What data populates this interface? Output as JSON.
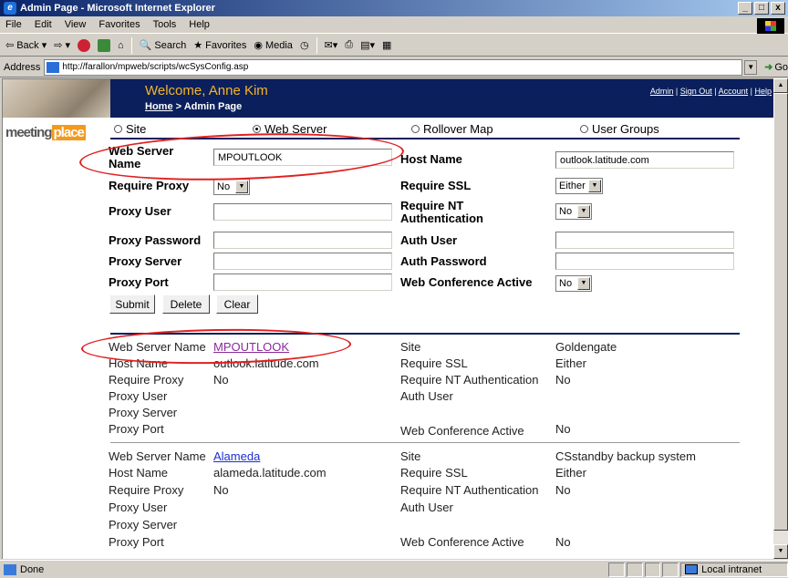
{
  "window": {
    "title": "Admin Page - Microsoft Internet Explorer",
    "controls": [
      "_",
      "□",
      "x"
    ]
  },
  "menu": [
    "File",
    "Edit",
    "View",
    "Favorites",
    "Tools",
    "Help"
  ],
  "toolbar": {
    "back": "Back",
    "search": "Search",
    "favorites": "Favorites",
    "media": "Media"
  },
  "address": {
    "label": "Address",
    "url": "http://farallon/mpweb/scripts/wcSysConfig.asp",
    "go": "Go"
  },
  "status": {
    "text": "Done",
    "zone": "Local intranet"
  },
  "header": {
    "welcome": "Welcome, Anne Kim",
    "breadcrumb_home": "Home",
    "breadcrumb_sep": " > ",
    "breadcrumb_page": "Admin Page",
    "links": [
      "Admin",
      "Sign Out",
      "Account",
      "Help"
    ]
  },
  "logo": {
    "part1": "meeting",
    "part2": "place"
  },
  "tabs": [
    {
      "label": "Site",
      "selected": false
    },
    {
      "label": "Web Server",
      "selected": true
    },
    {
      "label": "Rollover Map",
      "selected": false
    },
    {
      "label": "User Groups",
      "selected": false
    }
  ],
  "form": {
    "web_server_name": {
      "label": "Web Server Name",
      "value": "MPOUTLOOK"
    },
    "host_name": {
      "label": "Host Name",
      "value": "outlook.latitude.com"
    },
    "require_proxy": {
      "label": "Require Proxy",
      "value": "No"
    },
    "require_ssl": {
      "label": "Require SSL",
      "value": "Either"
    },
    "proxy_user": {
      "label": "Proxy User",
      "value": ""
    },
    "require_nt": {
      "label": "Require NT Authentication",
      "value": "No"
    },
    "proxy_password": {
      "label": "Proxy Password",
      "value": ""
    },
    "auth_user": {
      "label": "Auth User",
      "value": ""
    },
    "proxy_server": {
      "label": "Proxy Server",
      "value": ""
    },
    "auth_password": {
      "label": "Auth Password",
      "value": ""
    },
    "proxy_port": {
      "label": "Proxy Port",
      "value": ""
    },
    "web_conf_active": {
      "label": "Web Conference Active",
      "value": "No"
    },
    "buttons": {
      "submit": "Submit",
      "delete": "Delete",
      "clear": "Clear"
    }
  },
  "records": [
    {
      "labels": {
        "name": "Web Server Name",
        "host": "Host Name",
        "proxy": "Require Proxy",
        "puser": "Proxy User",
        "pserver": "Proxy Server",
        "pport": "Proxy Port",
        "site": "Site",
        "ssl": "Require SSL",
        "nt": "Require NT Authentication",
        "auth": "Auth User",
        "wca": "Web Conference Active"
      },
      "name": "MPOUTLOOK",
      "host": "outlook.latitude.com",
      "proxy": "No",
      "site": "Goldengate",
      "ssl": "Either",
      "nt": "No",
      "wca": "No"
    },
    {
      "labels": {
        "name": "Web Server Name",
        "host": "Host Name",
        "proxy": "Require Proxy",
        "puser": "Proxy User",
        "pserver": "Proxy Server",
        "pport": "Proxy Port",
        "site": "Site",
        "ssl": "Require SSL",
        "nt": "Require NT Authentication",
        "auth": "Auth User",
        "wca": "Web Conference Active"
      },
      "name": "Alameda",
      "host": "alameda.latitude.com",
      "proxy": "No",
      "site": "CSstandby backup system",
      "ssl": "Either",
      "nt": "No",
      "wca": "No"
    }
  ],
  "colors": {
    "header_bg": "#0a1f5c",
    "welcome": "#f4b52a",
    "annotation": "#e02020",
    "visited_link": "#8a2a9a",
    "link": "#1b2fd1"
  }
}
